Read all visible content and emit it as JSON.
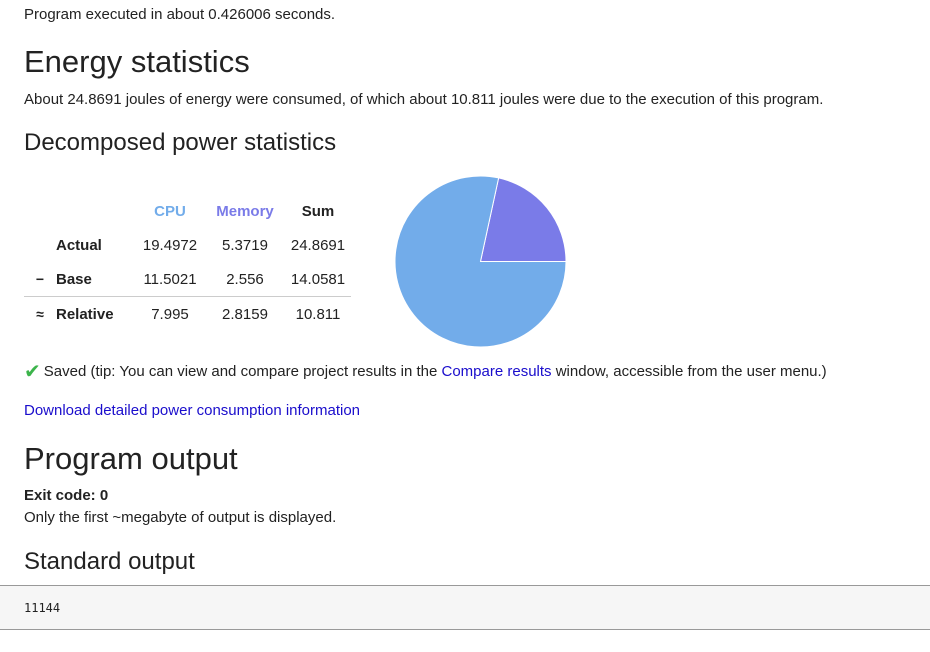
{
  "exec": {
    "text": "Program executed in about 0.426006 seconds."
  },
  "energy": {
    "title": "Energy statistics",
    "summary": "About 24.8691 joules of energy were consumed, of which about 10.811 joules were due to the execution of this program."
  },
  "decomposed": {
    "title": "Decomposed power statistics",
    "headers": {
      "cpu": "CPU",
      "memory": "Memory",
      "sum": "Sum"
    },
    "rows": [
      {
        "op": "",
        "label": "Actual",
        "cpu": "19.4972",
        "memory": "5.3719",
        "sum": "24.8691"
      },
      {
        "op": "−",
        "label": "Base",
        "cpu": "11.5021",
        "memory": "2.556",
        "sum": "14.0581"
      },
      {
        "op": "≈",
        "label": "Relative",
        "cpu": "7.995",
        "memory": "2.8159",
        "sum": "10.811"
      }
    ],
    "colors": {
      "cpu": "#72acea",
      "memory": "#7a7be8"
    }
  },
  "chart_data": {
    "type": "pie",
    "categories": [
      "CPU",
      "Memory"
    ],
    "values": [
      19.4972,
      5.3719
    ],
    "colors": [
      "#72acea",
      "#7a7be8"
    ]
  },
  "saved": {
    "check_icon": "check-icon",
    "prefix": "Saved (tip: You can view and compare project results in the ",
    "link": "Compare results",
    "suffix": " window, accessible from the user menu.)"
  },
  "download": {
    "label": "Download detailed power consumption information"
  },
  "program_output": {
    "title": "Program output",
    "exit_code": "Exit code: 0",
    "note": "Only the first ~megabyte of output is displayed."
  },
  "stdout": {
    "title": "Standard output",
    "content": "11144"
  }
}
